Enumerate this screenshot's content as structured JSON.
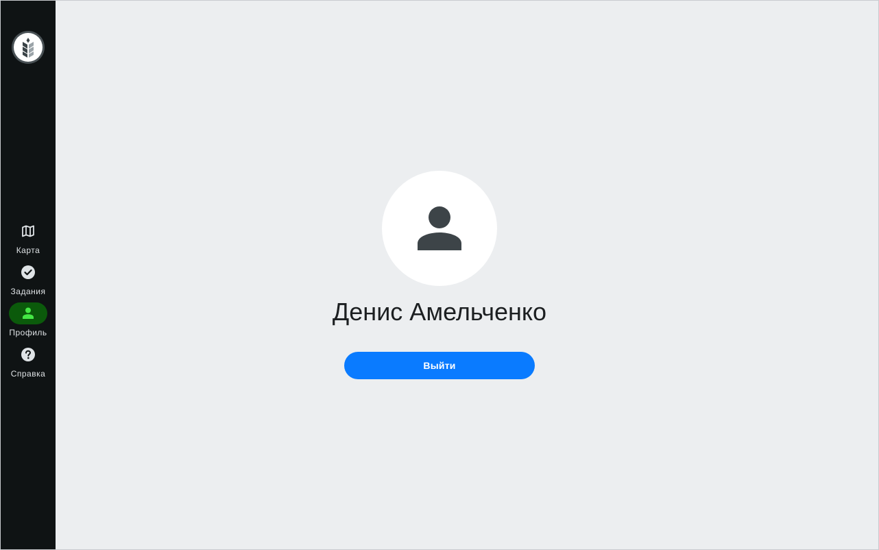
{
  "sidebar": {
    "logo_icon": "wheat-logo-icon",
    "items": [
      {
        "label": "Карта",
        "icon": "map-icon",
        "active": false
      },
      {
        "label": "Задания",
        "icon": "check-circle-icon",
        "active": false
      },
      {
        "label": "Профиль",
        "icon": "person-icon",
        "active": true
      },
      {
        "label": "Справка",
        "icon": "help-circle-icon",
        "active": false
      }
    ]
  },
  "profile": {
    "avatar_icon": "person-icon",
    "name": "Денис Амельченко",
    "logout_label": "Выйти"
  },
  "colors": {
    "sidebar_bg": "#0f1314",
    "content_bg": "#eceef0",
    "active_pill": "#0b5a0b",
    "active_icon": "#45e845",
    "accent": "#0a7bff",
    "avatar_icon": "#3d4448"
  }
}
